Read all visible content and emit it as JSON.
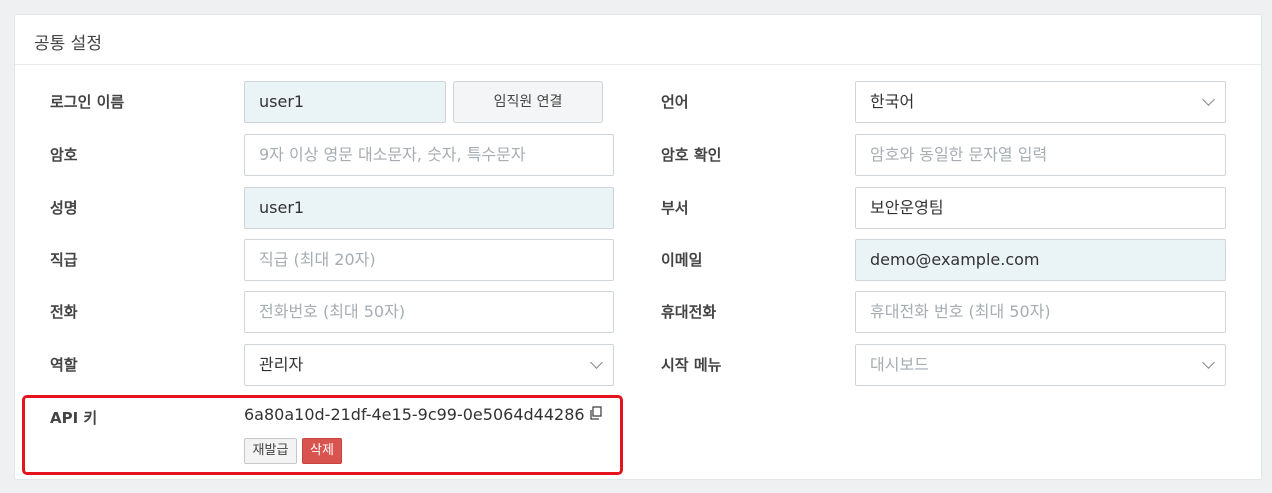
{
  "panel": {
    "title": "공통 설정"
  },
  "left": {
    "login_name": {
      "label": "로그인 이름",
      "value": "user1",
      "link_button": "임직원 연결"
    },
    "password": {
      "label": "암호",
      "placeholder": "9자 이상 영문 대소문자, 숫자, 특수문자"
    },
    "name": {
      "label": "성명",
      "value": "user1"
    },
    "position": {
      "label": "직급",
      "placeholder": "직급 (최대 20자)"
    },
    "phone": {
      "label": "전화",
      "placeholder": "전화번호 (최대 50자)"
    },
    "role": {
      "label": "역할",
      "value": "관리자"
    }
  },
  "right": {
    "language": {
      "label": "언어",
      "value": "한국어"
    },
    "password_confirm": {
      "label": "암호 확인",
      "placeholder": "암호와 동일한 문자열 입력"
    },
    "department": {
      "label": "부서",
      "value": "보안운영팀"
    },
    "email": {
      "label": "이메일",
      "value": "demo@example.com"
    },
    "mobile": {
      "label": "휴대전화",
      "placeholder": "휴대전화 번호 (최대 50자)"
    },
    "start_menu": {
      "label": "시작 메뉴",
      "placeholder": "대시보드"
    }
  },
  "api": {
    "label": "API 키",
    "key": "6a80a10d-21df-4e15-9c99-0e5064d44286",
    "reissue_button": "재발급",
    "delete_button": "삭제"
  },
  "colors": {
    "highlight": "#e5141c",
    "danger": "#d9534f",
    "readonly_bg": "#eaf3f6"
  }
}
